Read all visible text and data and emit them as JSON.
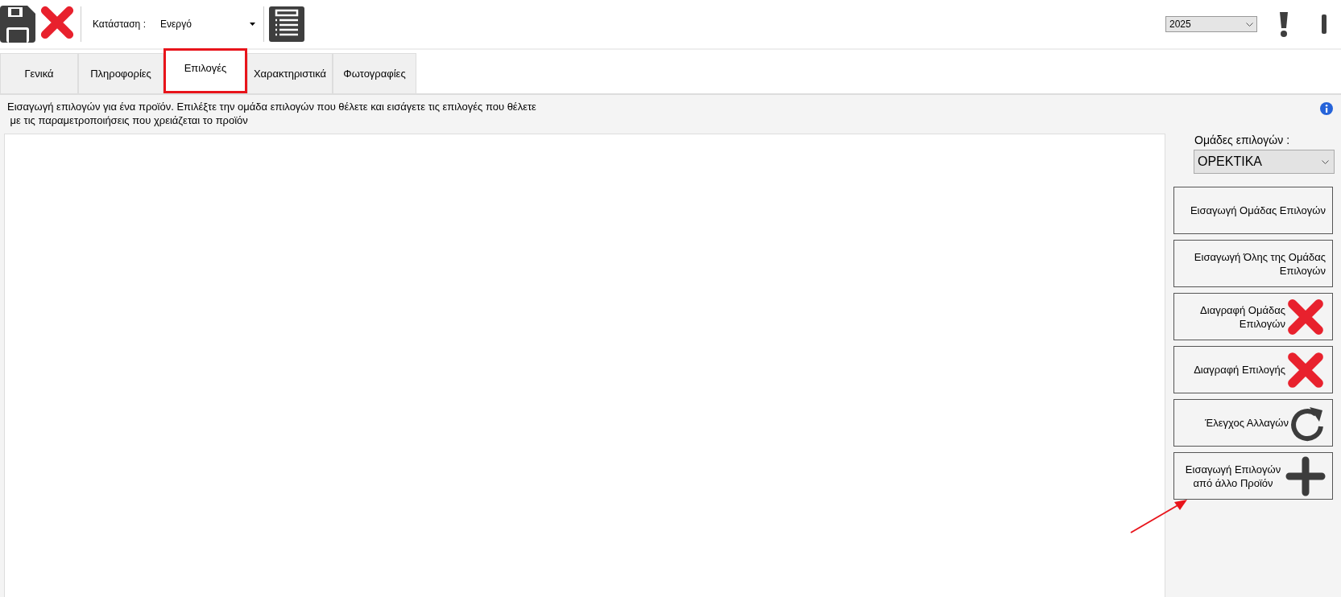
{
  "toolbar": {
    "status_label": "Κατάσταση :",
    "status_value": "Ενεργό",
    "year": "2025"
  },
  "tabs": [
    {
      "label": "Γενικά",
      "selected": false
    },
    {
      "label": "Πληροφορίες",
      "selected": false
    },
    {
      "label": "Επιλογές",
      "selected": true
    },
    {
      "label": "Χαρακτηριστικά",
      "selected": false
    },
    {
      "label": "Φωτογραφίες",
      "selected": false
    }
  ],
  "description": [
    "Εισαγωγή επιλογών για ένα προϊόν. Επιλέξτε την ομάδα επιλογών που θέλετε και εισάγετε τις επιλογές που θέλετε",
    " με τις παραμετροποιήσεις που χρειάζεται το προϊόν"
  ],
  "option_groups": {
    "label": "Ομάδες επιλογών :",
    "value": "OPEKTIKA"
  },
  "actions": [
    {
      "kind": "text",
      "lines": [
        "Εισαγωγή Ομάδας Επιλογών"
      ]
    },
    {
      "kind": "text",
      "lines": [
        "Εισαγωγή Όλης της Ομάδας",
        "Επιλογών"
      ]
    },
    {
      "kind": "delete",
      "lines": [
        "Διαγραφή Ομάδας",
        "Επιλογών"
      ]
    },
    {
      "kind": "delete",
      "lines": [
        "Διαγραφή Επιλογής"
      ]
    },
    {
      "kind": "refresh",
      "lines": [
        "Έλεγχος Αλλαγών"
      ]
    },
    {
      "kind": "add",
      "lines": [
        "Εισαγωγή Επιλογών",
        "από άλλο Προϊόν"
      ]
    }
  ]
}
